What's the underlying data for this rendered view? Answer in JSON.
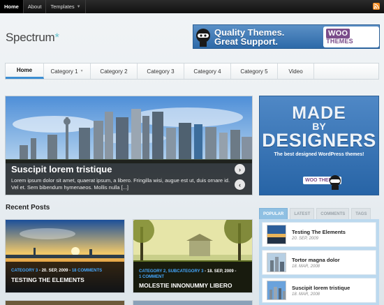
{
  "topbar": {
    "links": [
      {
        "label": "Home"
      },
      {
        "label": "About"
      },
      {
        "label": "Templates"
      }
    ]
  },
  "logo": {
    "name": "Spectrum",
    "mark": "*"
  },
  "banner": {
    "line1": "Quality Themes.",
    "line2": "Great Support.",
    "brand_a": "WOO",
    "brand_b": "THEMES"
  },
  "nav": {
    "items": [
      {
        "label": "Home"
      },
      {
        "label": "Category 1"
      },
      {
        "label": "Category 2"
      },
      {
        "label": "Category 3"
      },
      {
        "label": "Category 4"
      },
      {
        "label": "Category 5"
      },
      {
        "label": "Video"
      }
    ]
  },
  "featured": {
    "title": "Suscipit lorem tristique",
    "excerpt": "Lorem ipsum dolor sit amet, quaerat ipsum, a libero. Fringilla wisi, augue est ut, duis ornare id. Vel et. Sem bibendum hymenaeos. Mollis nulla [...]"
  },
  "side_ad": {
    "made": "MADE",
    "by": "BY",
    "designers": "DESIGNERS",
    "sub": "The best designed WordPress themes!",
    "brand": "WOO THEMES"
  },
  "recent": {
    "heading": "Recent Posts",
    "posts": [
      {
        "cat": "CATEGORY 3",
        "date": " - 20. SEP, 2009 - ",
        "comments": "18 COMMENTS",
        "title": "TESTING THE ELEMENTS"
      },
      {
        "cat": "CATEGORY 2, SUBCATEGORY 3",
        "date": " - 18. SEP, 2009 - ",
        "comments": "1 COMMENT",
        "title": "MOLESTIE INNONUMMY LIBERO"
      }
    ]
  },
  "tabs": {
    "labels": [
      "POPULAR",
      "LATEST",
      "COMMENTS",
      "TAGS"
    ],
    "items": [
      {
        "title": "Testing The Elements",
        "date": "20. SEP, 2009"
      },
      {
        "title": "Tortor magna dolor",
        "date": "18. MAR, 2008"
      },
      {
        "title": "Suscipit lorem tristique",
        "date": "18. MAR, 2008"
      }
    ]
  },
  "colors": {
    "accent": "#3c8ed2",
    "topbar": "#111111",
    "link_blue": "#45a8ff"
  }
}
